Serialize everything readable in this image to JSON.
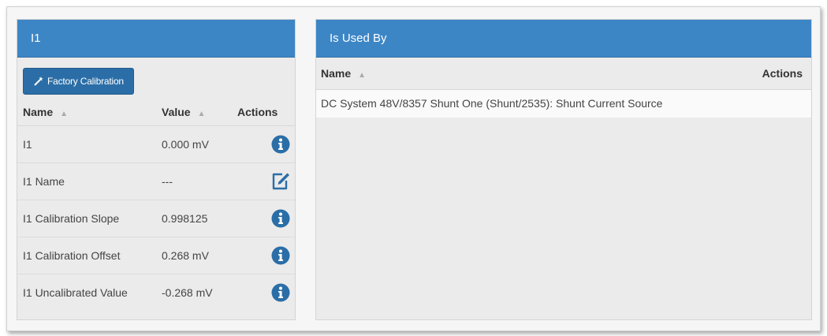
{
  "left_panel": {
    "title": "I1",
    "factory_button_label": "Factory Calibration",
    "columns": {
      "name": "Name",
      "value": "Value",
      "actions": "Actions"
    },
    "rows": [
      {
        "name": "I1",
        "value": "0.000 mV",
        "action_icon": "info-icon"
      },
      {
        "name": "I1 Name",
        "value": "---",
        "action_icon": "edit-icon"
      },
      {
        "name": "I1 Calibration Slope",
        "value": "0.998125",
        "action_icon": "info-icon"
      },
      {
        "name": "I1 Calibration Offset",
        "value": "0.268 mV",
        "action_icon": "info-icon"
      },
      {
        "name": "I1 Uncalibrated Value",
        "value": "-0.268 mV",
        "action_icon": "info-icon"
      }
    ]
  },
  "right_panel": {
    "title": "Is Used By",
    "columns": {
      "name": "Name",
      "actions": "Actions"
    },
    "rows": [
      {
        "name": "DC System 48V/8357 Shunt One (Shunt/2535): Shunt Current Source"
      }
    ]
  },
  "colors": {
    "header_blue": "#3d86c6",
    "button_blue": "#2b6ea7",
    "icon_blue": "#2b6ea7"
  },
  "icons": {
    "sort": "sort-icon",
    "wand": "magic-wand-icon",
    "info": "info-icon",
    "edit": "edit-icon"
  }
}
